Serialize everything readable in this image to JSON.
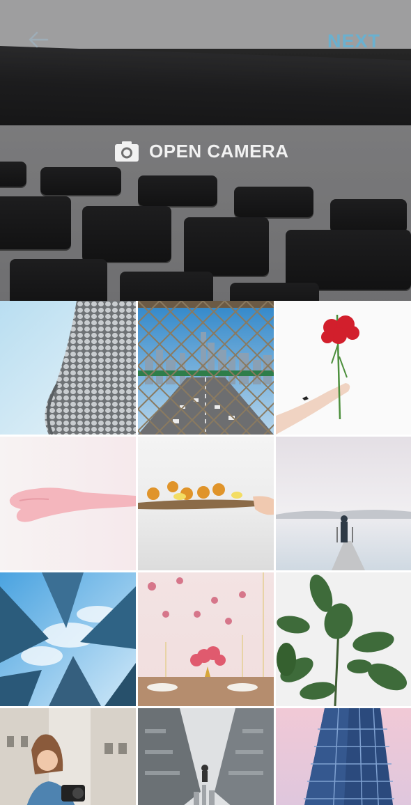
{
  "toolbar": {
    "back_icon": "arrow-left-icon",
    "next_label": "NEXT"
  },
  "camera": {
    "icon": "camera-icon",
    "open_label": "OPEN CAMERA"
  },
  "photos": [
    {
      "subject": "building-facade"
    },
    {
      "subject": "city-through-fence"
    },
    {
      "subject": "hand-with-red-flowers"
    },
    {
      "subject": "hand-in-milk"
    },
    {
      "subject": "fruit-board"
    },
    {
      "subject": "person-on-pier"
    },
    {
      "subject": "skyscrapers-looking-up"
    },
    {
      "subject": "dinner-table-flowers"
    },
    {
      "subject": "rubber-plant"
    },
    {
      "subject": "woman-with-camera"
    },
    {
      "subject": "reflective-buildings"
    },
    {
      "subject": "blue-glass-building"
    }
  ]
}
